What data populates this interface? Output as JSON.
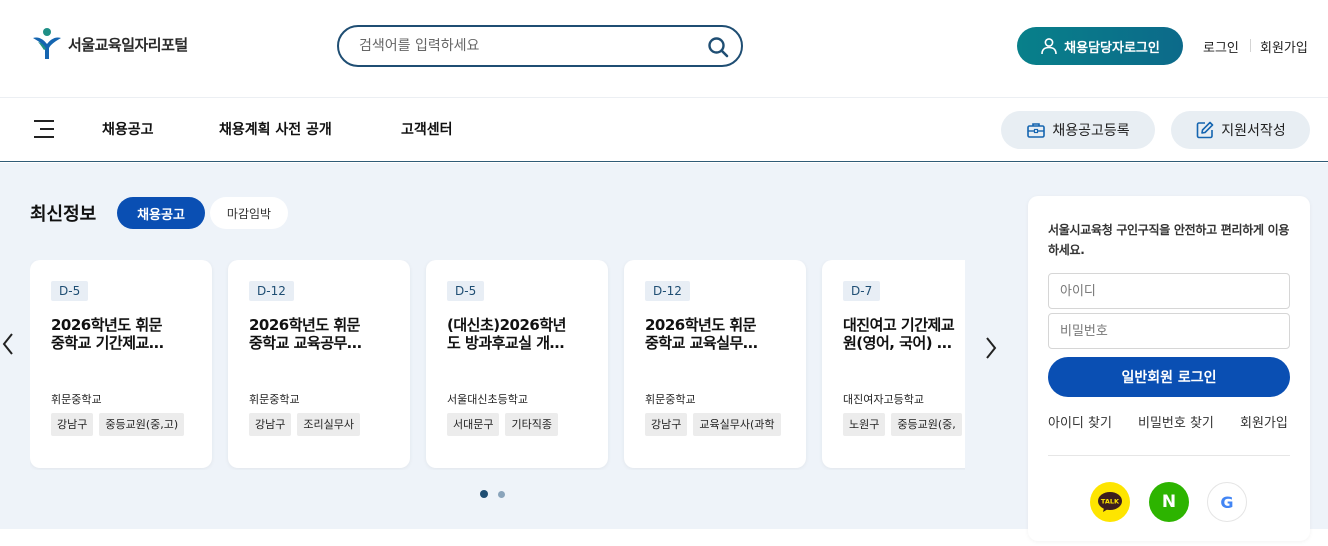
{
  "header": {
    "site_name": "서울교육일자리포털",
    "search_placeholder": "검색어를 입력하세요",
    "recruiter_login": "채용담당자로그인",
    "login": "로그인",
    "signup": "회원가입"
  },
  "nav": {
    "items": [
      "채용공고",
      "채용계획 사전 공개",
      "고객센터"
    ],
    "post_job": "채용공고등록",
    "write_application": "지원서작성"
  },
  "latest": {
    "title": "최신정보",
    "tabs": [
      "채용공고",
      "마감임박"
    ],
    "cards": [
      {
        "dday": "D-5",
        "title_line1": "2026학년도 휘문",
        "title_line2": "중학교 기간제교…",
        "school": "휘문중학교",
        "tags": [
          "강남구",
          "중등교원(중,고)"
        ]
      },
      {
        "dday": "D-12",
        "title_line1": "2026학년도 휘문",
        "title_line2": "중학교 교육공무…",
        "school": "휘문중학교",
        "tags": [
          "강남구",
          "조리실무사"
        ]
      },
      {
        "dday": "D-5",
        "title_line1": "(대신초)2026학년",
        "title_line2": "도 방과후교실 개…",
        "school": "서울대신초등학교",
        "tags": [
          "서대문구",
          "기타직종"
        ]
      },
      {
        "dday": "D-12",
        "title_line1": "2026학년도 휘문",
        "title_line2": "중학교 교육실무…",
        "school": "휘문중학교",
        "tags": [
          "강남구",
          "교육실무사(과학"
        ]
      },
      {
        "dday": "D-7",
        "title_line1": "대진여고 기간제교",
        "title_line2": "원(영어, 국어) …",
        "school": "대진여자고등학교",
        "tags": [
          "노원구",
          "중등교원(중,"
        ]
      }
    ]
  },
  "login_box": {
    "message": "서울시교육청 구인구직을 안전하고 편리하게 이용하세요.",
    "id_placeholder": "아이디",
    "pw_placeholder": "비밀번호",
    "login_button": "일반회원 로그인",
    "find_id": "아이디 찾기",
    "find_pw": "비밀번호 찾기",
    "signup": "회원가입",
    "kakao_label": "TALK",
    "naver_label": "N",
    "google_label": "G"
  },
  "colors": {
    "primary": "#0a4fb3",
    "teal": "#08808a",
    "navy": "#1f4e73",
    "bg": "#eef3f9",
    "kakao": "#fee500",
    "naver": "#2db400"
  }
}
